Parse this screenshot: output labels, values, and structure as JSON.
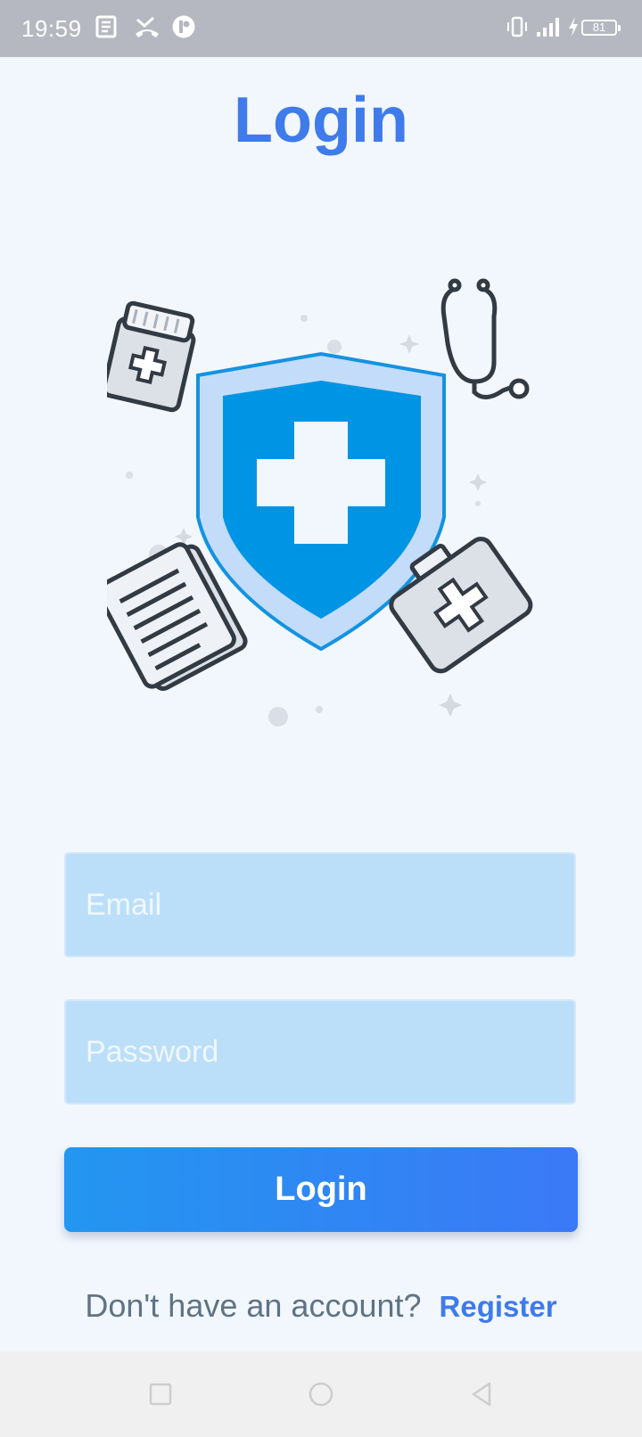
{
  "status_bar": {
    "time": "19:59",
    "battery": "81",
    "icons": [
      "news-icon",
      "missed-call-icon",
      "app-badge-icon",
      "vibrate-icon",
      "signal-icon",
      "charging-icon",
      "battery-icon"
    ]
  },
  "page": {
    "title": "Login"
  },
  "illustration": {
    "icons": [
      "shield-cross-icon",
      "medicine-jar-icon",
      "stethoscope-icon",
      "clipboard-icon",
      "first-aid-kit-icon"
    ],
    "accent_color": "#0094e4"
  },
  "form": {
    "email_placeholder": "Email",
    "password_placeholder": "Password",
    "login_label": "Login"
  },
  "footer": {
    "prompt": "Don't have an account?",
    "register_label": "Register"
  },
  "nav_bar": {
    "buttons": [
      "recent-apps-icon",
      "home-icon",
      "back-icon"
    ]
  },
  "colors": {
    "brand": "#3f7bea",
    "field_bg": "#bcdff9",
    "background": "#f2f7fe"
  }
}
